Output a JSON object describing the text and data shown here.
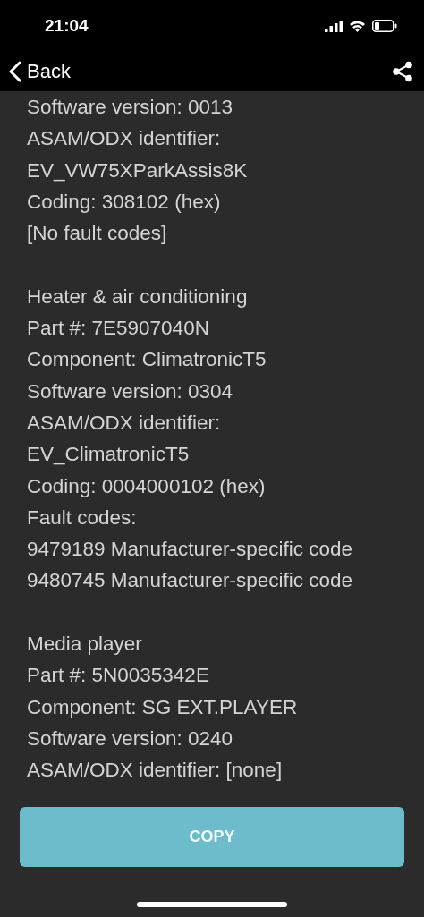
{
  "status_bar": {
    "time": "21:04"
  },
  "nav": {
    "back": "Back"
  },
  "sections": [
    {
      "lines": [
        "Software version: 0013",
        "ASAM/ODX identifier:",
        "EV_VW75XParkAssis8K",
        "Coding: 308102 (hex)",
        "[No fault codes]"
      ]
    },
    {
      "lines": [
        "Heater & air conditioning",
        "Part #: 7E5907040N",
        "Component: ClimatronicT5",
        "Software version: 0304",
        "ASAM/ODX identifier:",
        "EV_ClimatronicT5",
        "Coding: 0004000102 (hex)",
        "Fault codes:",
        "9479189 Manufacturer-specific code",
        "9480745 Manufacturer-specific code"
      ]
    },
    {
      "lines": [
        "Media player",
        "Part #: 5N0035342E",
        "Component: SG EXT.PLAYER",
        "Software version: 0240",
        "ASAM/ODX identifier: [none]"
      ]
    }
  ],
  "copy_button": {
    "label": "COPY"
  }
}
